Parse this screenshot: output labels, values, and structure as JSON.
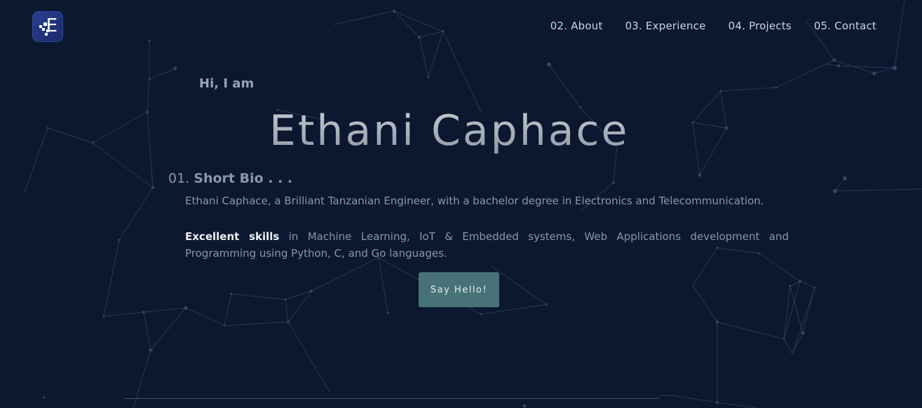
{
  "header": {
    "logo_icon": "logo-e-icon",
    "logo_letter": "E",
    "nav": [
      {
        "label": "02. About"
      },
      {
        "label": "03. Experience"
      },
      {
        "label": "04. Projects"
      },
      {
        "label": "05. Contact"
      }
    ]
  },
  "hero": {
    "greeting": "Hi, I am",
    "name": "Ethani Caphace"
  },
  "bio": {
    "number": "01.",
    "title": "Short Bio . . .",
    "paragraph1": "Ethani Caphace, a Brilliant Tanzanian Engineer, with a bachelor degree in Electronics and Telecommunication.",
    "highlight": "Excellent skills",
    "paragraph2_rest": " in Machine Learning, IoT & Embedded systems, Web Applications development and Programming using Python, C, and Go languages."
  },
  "cta": {
    "label": "Say Hello!"
  },
  "colors": {
    "background": "#0b1830",
    "button": "#477378",
    "logo": "#2a3f8f",
    "network_lines": "#2b3a55"
  }
}
